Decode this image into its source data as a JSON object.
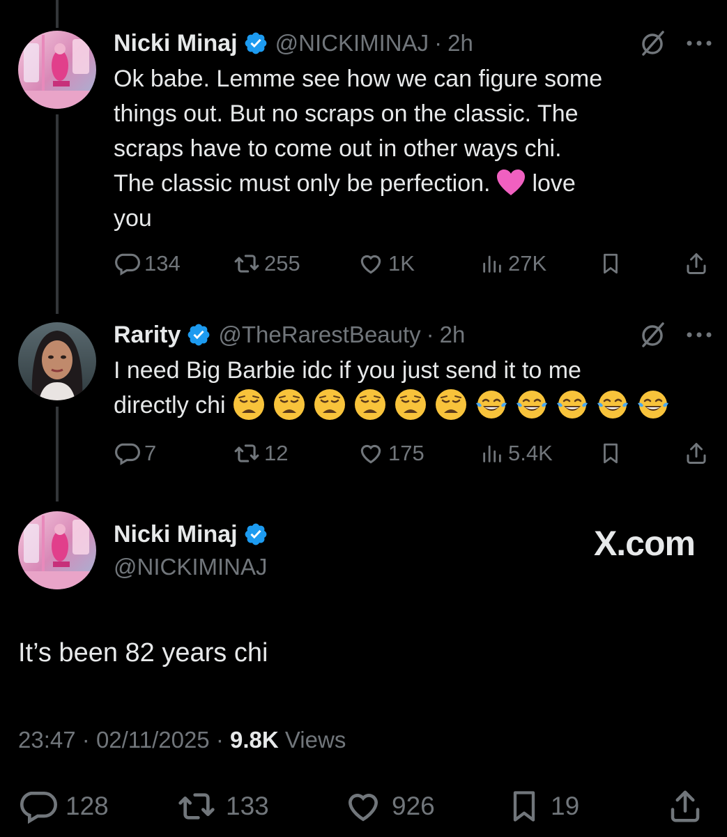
{
  "tweets": [
    {
      "name": "Nicki Minaj",
      "handle": "@NICKIMINAJ",
      "dot": "·",
      "time": "2h",
      "lines": [
        "Ok babe. Lemme see how we can figure some",
        "things out. But no scraps on the classic. The",
        "scraps have to come out in other ways chi.",
        "The classic must only be perfection.",
        "love",
        "you"
      ],
      "heart_emoji": "pink-heart",
      "stats": {
        "replies": "134",
        "reposts": "255",
        "likes": "1K",
        "views": "27K"
      }
    },
    {
      "name": "Rarity",
      "handle": "@TheRarestBeauty",
      "dot": "·",
      "time": "2h",
      "lines": [
        "I need Big Barbie idc if you just send it to me",
        "directly chi"
      ],
      "emojis": [
        "weary-face",
        "weary-face",
        "weary-face",
        "weary-face",
        "weary-face",
        "weary-face",
        "tears-of-joy",
        "tears-of-joy",
        "tears-of-joy",
        "tears-of-joy",
        "tears-of-joy"
      ],
      "stats": {
        "replies": "7",
        "reposts": "12",
        "likes": "175",
        "views": "5.4K"
      }
    }
  ],
  "main_tweet": {
    "name": "Nicki Minaj",
    "handle": "@NICKIMINAJ",
    "watermark": "X.com",
    "text": "It’s been 82 years chi",
    "time": "23:47",
    "sep": "·",
    "date": "02/11/2025",
    "views_count": "9.8K",
    "views_label": "Views",
    "stats": {
      "replies": "128",
      "reposts": "133",
      "likes": "926",
      "bookmarks": "19"
    }
  },
  "colors": {
    "background": "#000000",
    "text": "#e7e9ea",
    "secondary": "#71767b",
    "verified": "#1d9bf0",
    "thread_line": "#333639"
  }
}
